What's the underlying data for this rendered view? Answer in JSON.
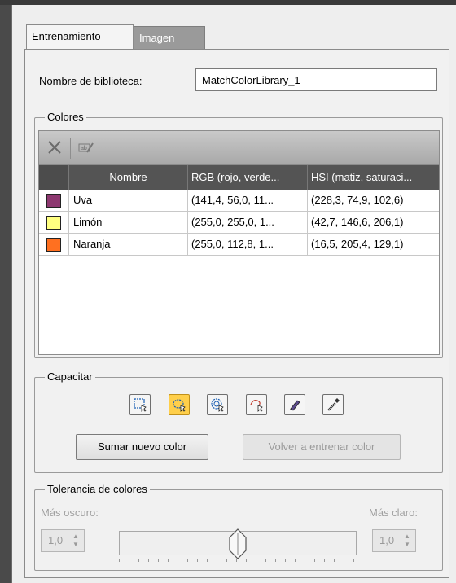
{
  "tabs": [
    {
      "label": "Entrenamiento",
      "active": true
    },
    {
      "label": "Imagen",
      "active": false
    }
  ],
  "library": {
    "label": "Nombre de biblioteca:",
    "value": "MatchColorLibrary_1"
  },
  "colores": {
    "title": "Colores",
    "toolbar": {
      "delete_icon": "close-x-icon",
      "rename_icon": "rename-text-icon"
    },
    "columns": [
      "Nombre",
      "RGB (rojo, verde...",
      "HSI (matiz, saturaci..."
    ],
    "rows": [
      {
        "name": "Uva",
        "rgb": "(141,4, 56,0, 11...",
        "hsi": "(228,3, 74,9, 102,6)",
        "color": "#8d3870"
      },
      {
        "name": "Limón",
        "rgb": "(255,0, 255,0, 1...",
        "hsi": "(42,7, 146,6, 206,1)",
        "color": "#ffff80"
      },
      {
        "name": "Naranja",
        "rgb": "(255,0, 112,8, 1...",
        "hsi": "(16,5, 205,4, 129,1)",
        "color": "#ff7020"
      }
    ]
  },
  "capacitar": {
    "title": "Capacitar",
    "tools": [
      {
        "icon": "rectangle-select-icon",
        "active": false
      },
      {
        "icon": "lasso-select-icon",
        "active": true
      },
      {
        "icon": "magic-wand-select-icon",
        "active": false
      },
      {
        "icon": "freeform-select-icon",
        "active": false
      },
      {
        "icon": "brush-icon",
        "active": false
      },
      {
        "icon": "eyedropper-icon",
        "active": false
      }
    ],
    "add_button": "Sumar nuevo color",
    "retrain_button": "Volver a entrenar color"
  },
  "tolerancia": {
    "title": "Tolerancia de colores",
    "darker_label": "Más oscuro:",
    "lighter_label": "Más claro:",
    "darker_value": "1,0",
    "lighter_value": "1,0",
    "slider_position": 0.5
  }
}
